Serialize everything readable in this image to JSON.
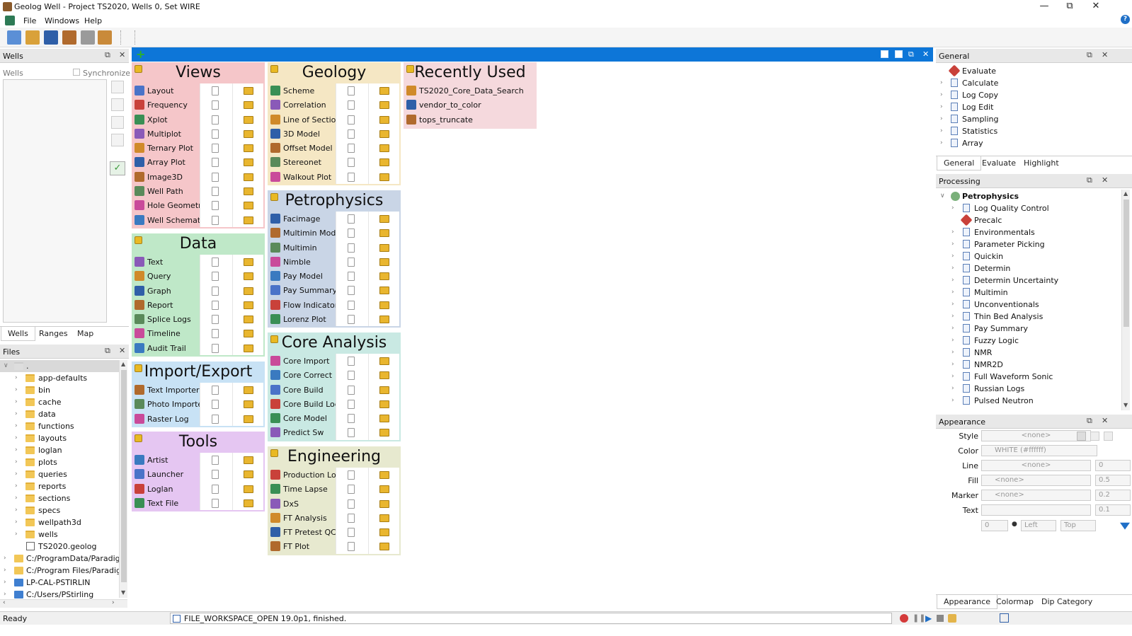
{
  "window": {
    "title": "Geolog Well - Project TS2020, Wells 0, Set WIRE"
  },
  "menu": [
    "File",
    "Windows",
    "Help"
  ],
  "wells_panel": {
    "title": "Wells",
    "label": "Wells",
    "synchronize": "Synchronize",
    "tabs": [
      "Wells",
      "Ranges",
      "Map"
    ]
  },
  "files_panel": {
    "title": "Files",
    "root": ".",
    "folders": [
      "app-defaults",
      "bin",
      "cache",
      "data",
      "functions",
      "layouts",
      "loglan",
      "plots",
      "queries",
      "reports",
      "sections",
      "specs",
      "wellpath3d",
      "wells"
    ],
    "file": "TS2020.geolog",
    "roots": [
      "C:/ProgramData/Paradigm/",
      "C:/Program Files/Paradigm/",
      "LP-CAL-PSTIRLIN",
      "C:/Users/PStirling"
    ]
  },
  "launcher": {
    "groups": [
      {
        "title": "Views",
        "color": "#f5c6c9",
        "items": [
          "Layout",
          "Frequency",
          "Xplot",
          "Multiplot",
          "Ternary Plot",
          "Array Plot",
          "Image3D",
          "Well Path",
          "Hole Geometry",
          "Well Schematic"
        ]
      },
      {
        "title": "Data",
        "color": "#bfe8c8",
        "items": [
          "Text",
          "Query",
          "Graph",
          "Report",
          "Splice Logs",
          "Timeline",
          "Audit Trail"
        ]
      },
      {
        "title": "Import/Export",
        "color": "#c8e2f5",
        "items": [
          "Text Importer",
          "Photo Importer",
          "Raster Log"
        ]
      },
      {
        "title": "Tools",
        "color": "#e5c6f2",
        "items": [
          "Artist",
          "Launcher",
          "Loglan",
          "Text File"
        ]
      },
      {
        "title": "Geology",
        "color": "#f5e7c4",
        "items": [
          "Scheme",
          "Correlation",
          "Line of Section",
          "3D Model",
          "Offset Model",
          "Stereonet",
          "Walkout Plot"
        ]
      },
      {
        "title": "Petrophysics",
        "color": "#c9d5e6",
        "items": [
          "Facimage",
          "Multimin Model",
          "Multimin",
          "Nimble",
          "Pay Model",
          "Pay Summary",
          "Flow Indicators",
          "Lorenz Plot"
        ]
      },
      {
        "title": "Core Analysis",
        "color": "#c9e9e3",
        "items": [
          "Core Import",
          "Core Correct",
          "Core Build",
          "Core Build Log",
          "Core Model",
          "Predict Sw"
        ]
      },
      {
        "title": "Engineering",
        "color": "#e7e9cf",
        "items": [
          "Production Log",
          "Time Lapse",
          "DxS",
          "FT Analysis",
          "FT Pretest QC",
          "FT Plot"
        ]
      },
      {
        "title": "Recently Used",
        "color": "#f5d9dd",
        "items": [
          "TS2020_Core_Data_Search",
          "vendor_to_color",
          "tops_truncate"
        ]
      }
    ]
  },
  "general_panel": {
    "title": "General",
    "items": [
      "Evaluate",
      "Calculate",
      "Log Copy",
      "Log Edit",
      "Sampling",
      "Statistics",
      "Array"
    ],
    "tabs": [
      "General",
      "Evaluate",
      "Highlight"
    ]
  },
  "processing_panel": {
    "title": "Processing",
    "root": "Petrophysics",
    "items": [
      "Log Quality Control",
      "Precalc",
      "Environmentals",
      "Parameter Picking",
      "Quickin",
      "Determin",
      "Determin Uncertainty",
      "Multimin",
      "Unconventionals",
      "Thin Bed Analysis",
      "Pay Summary",
      "Fuzzy Logic",
      "NMR",
      "NMR2D",
      "Full Waveform Sonic",
      "Russian Logs",
      "Pulsed Neutron"
    ]
  },
  "appearance_panel": {
    "title": "Appearance",
    "labels": [
      "Style",
      "Color",
      "Line",
      "Fill",
      "Marker",
      "Text"
    ],
    "style_value": "<none>",
    "color_value": "WHITE (#ffffff)",
    "line_value": "<none>",
    "line_num": "0",
    "fill_value": "<none>",
    "fill_num": "0.5",
    "marker_value": "<none>",
    "marker_num": "0.2",
    "text_num": "0.1",
    "angle": "0",
    "halign": "Left",
    "valign": "Top",
    "tabs": [
      "Appearance",
      "Colormap",
      "Dip Category"
    ]
  },
  "status": {
    "left": "Ready",
    "message": "FILE_WORKSPACE_OPEN 19.0p1, finished."
  }
}
